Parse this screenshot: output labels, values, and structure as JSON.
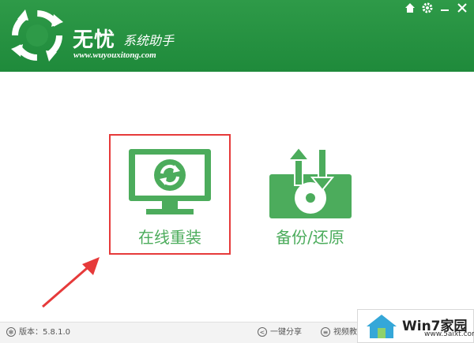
{
  "header": {
    "title": "无忧",
    "subtitle": "系统助手",
    "url": "www.wuyouxitong.com"
  },
  "window_controls": [
    "home-icon",
    "gear-icon",
    "minimize-icon",
    "close-icon"
  ],
  "tiles": [
    {
      "label": "在线重装",
      "icon": "monitor-refresh-icon"
    },
    {
      "label": "备份/还原",
      "icon": "disk-backup-icon"
    }
  ],
  "footer": {
    "version": "版本：5.8.1.0",
    "share": "一键分享",
    "video": "视频教"
  },
  "watermark": {
    "brand": "Win7家园",
    "site": "www.5aixt.com"
  },
  "colors": {
    "brand_green": "#1f8a3b",
    "accent_green": "#4cac5c",
    "highlight_red": "#e63a3a"
  }
}
